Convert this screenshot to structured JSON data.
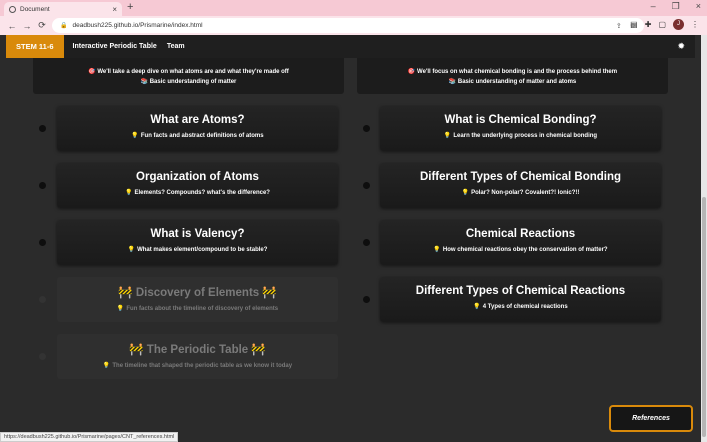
{
  "browser": {
    "tab_title": "Document",
    "tab_close": "×",
    "new_tab": "+",
    "window_buttons": [
      "–",
      "❐",
      "×"
    ],
    "nav": {
      "back": "←",
      "forward": "→",
      "reload": "⟳"
    },
    "url": "deadbush225.github.io/Prismarine/index.html",
    "profile_initial": "J",
    "status_url": "https://deadbush225.github.io/Prismarine/pages/CNT_references.html"
  },
  "navbar": {
    "brand": "STEM 11-6",
    "links": [
      "Interactive Periodic Table",
      "Team"
    ],
    "theme_icon": "✹"
  },
  "intro": {
    "left": {
      "line1": "🎯 We'll take a deep dive on what atoms are and what they're made off",
      "line2": "📚 Basic understanding of matter"
    },
    "right": {
      "line1": "🎯 We'll focus on what chemical bonding is and the process behind them",
      "line2": "📚 Basic understanding of matter and atoms"
    }
  },
  "atoms_cards": [
    {
      "title": "What are Atoms?",
      "subtitle": "Fun facts and abstract definitions of atoms"
    },
    {
      "title": "Organization of Atoms",
      "subtitle": "Elements? Compounds? what's the difference?"
    },
    {
      "title": "What is Valency?",
      "subtitle": "What makes element/compound to be stable?"
    },
    {
      "title": "Discovery of Elements",
      "subtitle": "Fun facts about the timeline of discovery of elements"
    },
    {
      "title": "The Periodic Table",
      "subtitle": "The timeline that shaped the periodic table as we know it today"
    }
  ],
  "bonding_cards": [
    {
      "title": "What is Chemical Bonding?",
      "subtitle": "Learn the underlying process in chemical bonding"
    },
    {
      "title": "Different Types of Chemical Bonding",
      "subtitle": "Polar? Non-polar? Covalent?! Ionic?!!"
    },
    {
      "title": "Chemical Reactions",
      "subtitle": "How chemical reactions obey the conservation of matter?"
    },
    {
      "title": "Different Types of Chemical Reactions",
      "subtitle": "4 Types of chemical reactions"
    }
  ],
  "icons": {
    "bulb": "💡",
    "hazard": "🚧"
  },
  "references_button": "References",
  "colors": {
    "accent": "#d98a0b",
    "page_bg": "#2b2b2b",
    "card_bg": "#1e1e1e",
    "chrome": "#f6c9d4"
  }
}
